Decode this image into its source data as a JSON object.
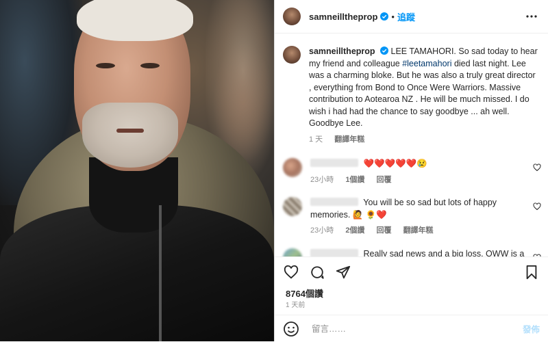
{
  "header": {
    "username": "samneilltheprop",
    "follow_label": "追蹤",
    "dot": "•"
  },
  "caption": {
    "username": "samneilltheprop",
    "text_before": "LEE TAMAHORI. So sad today to hear my friend and colleague ",
    "hashtag": "#leetamahori",
    "text_after": " died last night. Lee was a charming bloke. But he was also a truly great director , everything from Bond to Once Were Warriors. Massive contribution to Aotearoa NZ . He will be much missed. I do wish i had had the chance to say goodbye ... ah well. Goodbye Lee.",
    "time": "1 天",
    "translate": "翻譯年糕"
  },
  "comments": [
    {
      "text": "❤️❤️❤️❤️❤️😢",
      "time": "23小時",
      "likes": "1個讚",
      "reply": "回覆"
    },
    {
      "text": "You will be so sad but lots of happy memories. 🙋 🌻❤️",
      "time": "23小時",
      "likes": "2個讚",
      "reply": "回覆",
      "translate": "翻譯年糕"
    },
    {
      "text": "Really sad news and a big loss. OWW is a landmark film. I wept uncontrollably even though it was at an industry screening.. I worked with Lee before he started directing. It was an expensive and problematic production"
    }
  ],
  "stats": {
    "likes": "8764個讚",
    "date": "1 天前"
  },
  "add_comment": {
    "placeholder": "留言……",
    "post_label": "發佈"
  },
  "colors": {
    "accent": "#0095f6",
    "hashtag": "#00376b",
    "muted": "#8e8e8e"
  }
}
